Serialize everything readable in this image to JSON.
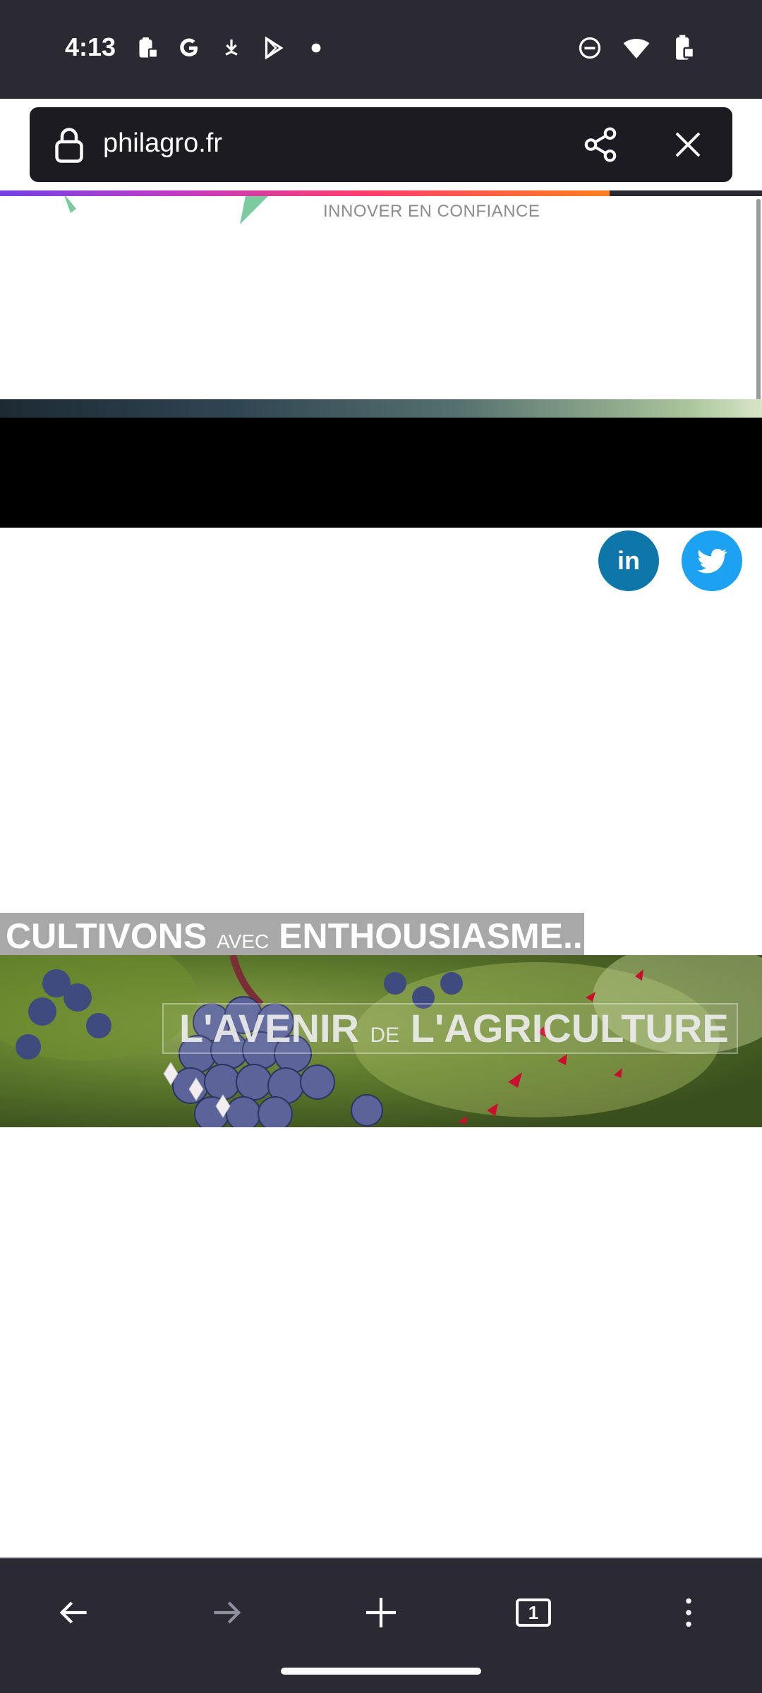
{
  "status_bar": {
    "time": "4:13",
    "left_icons": [
      "clipboard-lock-icon",
      "google-icon",
      "download-icon",
      "play-store-icon",
      "dot-icon"
    ],
    "right_icons": [
      "do-not-disturb-icon",
      "wifi-icon",
      "battery-icon"
    ]
  },
  "url_bar": {
    "url": "philagro.fr"
  },
  "page_load_progress": 0.8,
  "page": {
    "logo_tagline": "INNOVER EN CONFIANCE",
    "social": {
      "linkedin_label": "in"
    },
    "banner": {
      "headline_part1": "CULTIVONS",
      "headline_small": "AVEC",
      "headline_part2": "ENTHOUSIASME...",
      "subtitle_part1": "L'AVENIR",
      "subtitle_small": "DE",
      "subtitle_part2": "L'AGRICULTURE"
    }
  },
  "toolbar": {
    "tab_count": "1"
  },
  "colors": {
    "chrome_bg": "#2b2a33",
    "url_bar_bg": "#1c1b22",
    "linkedin": "#0e76a8",
    "twitter": "#1da1f2"
  }
}
